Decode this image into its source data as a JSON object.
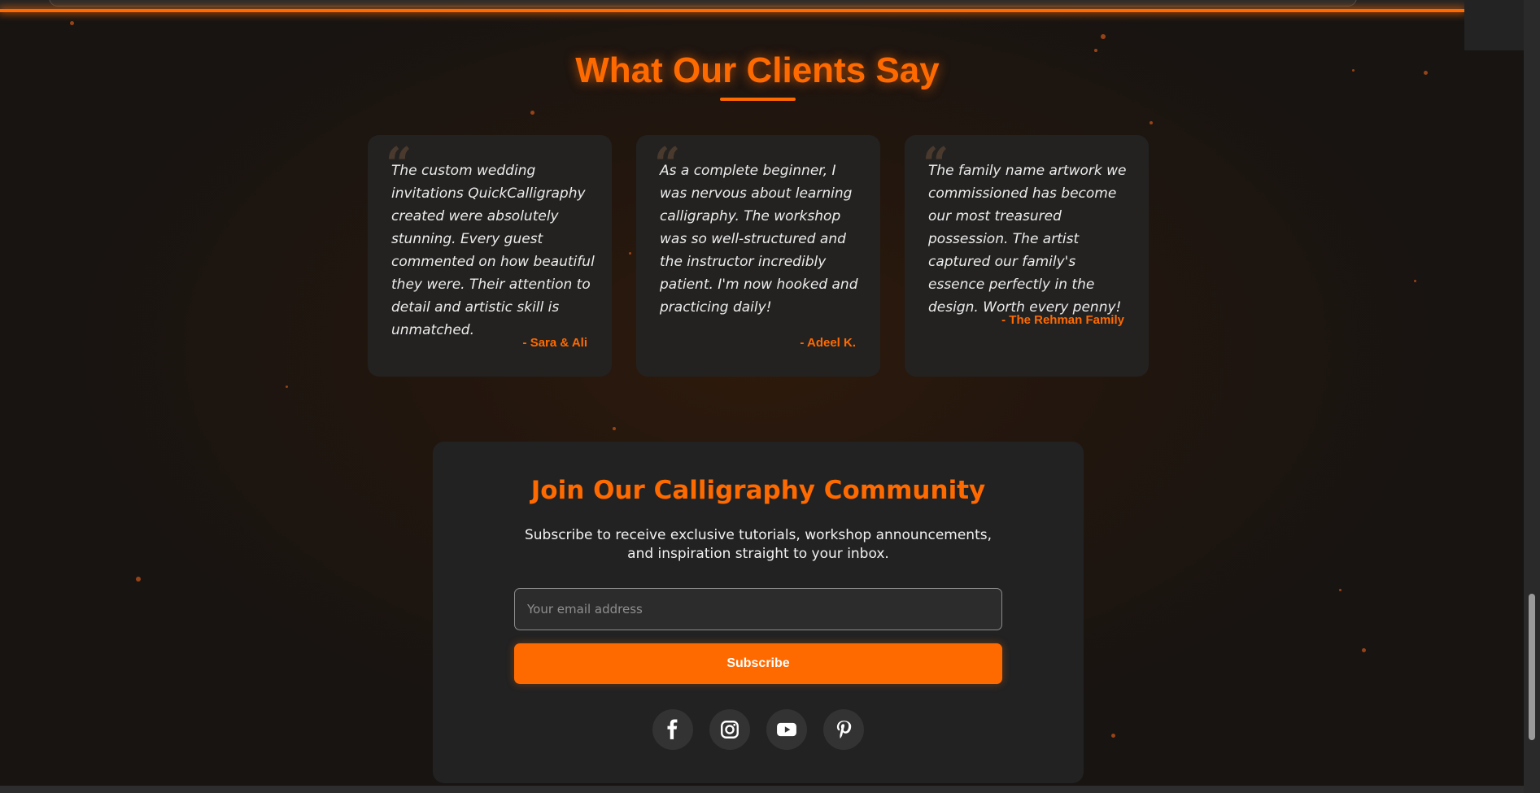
{
  "section": {
    "title": "What Our Clients Say"
  },
  "testimonials": [
    {
      "quote": "The custom wedding invitations QuickCalligraphy created were absolutely stunning. Every guest commented on how beautiful they were. Their attention to detail and artistic skill is unmatched.",
      "author": "- Sara & Ali"
    },
    {
      "quote": "As a complete beginner, I was nervous about learning calligraphy. The workshop was so well-structured and the instructor incredibly patient. I'm now hooked and practicing daily!",
      "author": "- Adeel K."
    },
    {
      "quote": "The family name artwork we commissioned has become our most treasured possession. The artist captured our family's essence perfectly in the design. Worth every penny!",
      "author": "- The Rehman Family"
    }
  ],
  "quote_glyph": "“",
  "community": {
    "title": "Join Our Calligraphy Community",
    "description": "Subscribe to receive exclusive tutorials, workshop announcements, and inspiration straight to your inbox.",
    "email_placeholder": "Your email address",
    "email_value": "",
    "subscribe_label": "Subscribe"
  },
  "social_icons": [
    "facebook-icon",
    "instagram-icon",
    "youtube-icon",
    "pinterest-icon"
  ],
  "colors": {
    "accent": "#ff6a00",
    "card_bg": "#232221",
    "panel_bg": "#222222",
    "page_bg": "#1b1714"
  }
}
